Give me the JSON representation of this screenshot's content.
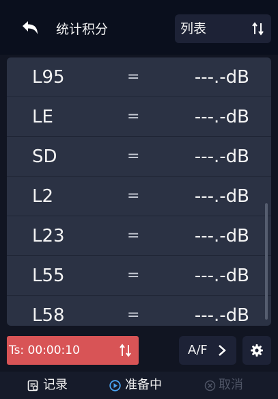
{
  "header": {
    "title": "统计积分",
    "view_select": "列表"
  },
  "list": {
    "rows": [
      {
        "name": "L95",
        "eq": "=",
        "value": "---.-dB"
      },
      {
        "name": "LE",
        "eq": "=",
        "value": "---.-dB"
      },
      {
        "name": "SD",
        "eq": "=",
        "value": "---.-dB"
      },
      {
        "name": "L2",
        "eq": "=",
        "value": "---.-dB"
      },
      {
        "name": "L23",
        "eq": "=",
        "value": "---.-dB"
      },
      {
        "name": "L55",
        "eq": "=",
        "value": "---.-dB"
      },
      {
        "name": "L58",
        "eq": "=",
        "value": "---.-dB"
      }
    ]
  },
  "controls": {
    "ts": "Ts: 00:00:10",
    "af_label": "A/F"
  },
  "toolbar": {
    "record": "记录",
    "ready": "准备中",
    "cancel": "取消"
  },
  "colors": {
    "background": "#111522",
    "list_bg": "#2b3244",
    "ts_red": "#d85456",
    "ready_blue": "#4aa3f0",
    "disabled": "#4f5566"
  },
  "icons": {
    "back": "back-arrow-icon",
    "sort": "sort-icon",
    "chevron": "chevron-right-icon",
    "gear": "gear-icon",
    "record": "record-icon",
    "ready": "play-circle-icon",
    "cancel": "cancel-circle-icon"
  }
}
